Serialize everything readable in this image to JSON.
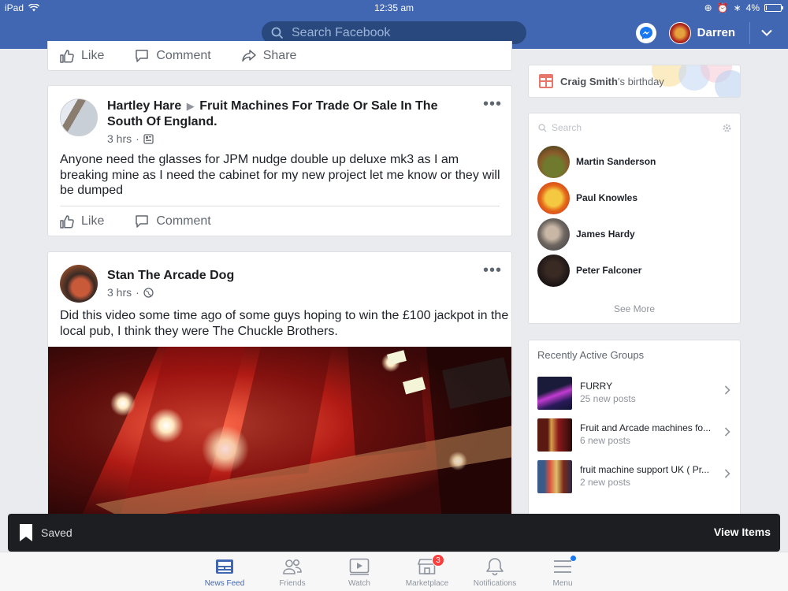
{
  "status_bar": {
    "device": "iPad",
    "time": "12:35 am",
    "battery": "4%",
    "battery_level": 0.04
  },
  "header": {
    "search_placeholder": "Search Facebook",
    "user_name": "Darren"
  },
  "feed": {
    "top_actions": {
      "like": "Like",
      "comment": "Comment",
      "share": "Share"
    },
    "posts": [
      {
        "author": "Hartley Hare",
        "group": "Fruit Machines For Trade Or Sale In The South Of England.",
        "time": "3 hrs",
        "text": "Anyone need the glasses for JPM nudge double up deluxe mk3 as I am breaking mine as I need the cabinet for my new project let me know or they will be dumped",
        "like": "Like",
        "comment": "Comment"
      },
      {
        "author": "Stan The Arcade Dog",
        "time": "3 hrs",
        "text": "Did this video some time ago of some guys hoping to win the £100 jackpot in the local pub, I think they were The Chuckle Brothers."
      }
    ]
  },
  "sidebar": {
    "birthday": {
      "name": "Craig Smith",
      "suffix": "'s birthday"
    },
    "contacts": {
      "search_placeholder": "Search",
      "items": [
        "Martin Sanderson",
        "Paul Knowles",
        "James Hardy",
        "Peter Falconer"
      ],
      "see_more": "See More"
    },
    "groups": {
      "title": "Recently Active Groups",
      "items": [
        {
          "name": "FURRY",
          "sub": "25 new posts"
        },
        {
          "name": "Fruit and Arcade machines fo...",
          "sub": "6 new posts"
        },
        {
          "name": "fruit machine support UK ( Pr...",
          "sub": "2 new posts"
        }
      ]
    }
  },
  "toast": {
    "label": "Saved",
    "action": "View Items"
  },
  "tabs": [
    {
      "label": "News Feed",
      "icon": "news-feed-icon"
    },
    {
      "label": "Friends",
      "icon": "friends-icon"
    },
    {
      "label": "Watch",
      "icon": "watch-icon"
    },
    {
      "label": "Marketplace",
      "icon": "marketplace-icon",
      "badge": "3"
    },
    {
      "label": "Notifications",
      "icon": "notifications-icon"
    },
    {
      "label": "Menu",
      "icon": "menu-icon"
    }
  ],
  "colors": {
    "brand": "#4267b2",
    "search_bg": "#29487d",
    "background": "#e9ebee",
    "badge": "#fa3e3e"
  }
}
